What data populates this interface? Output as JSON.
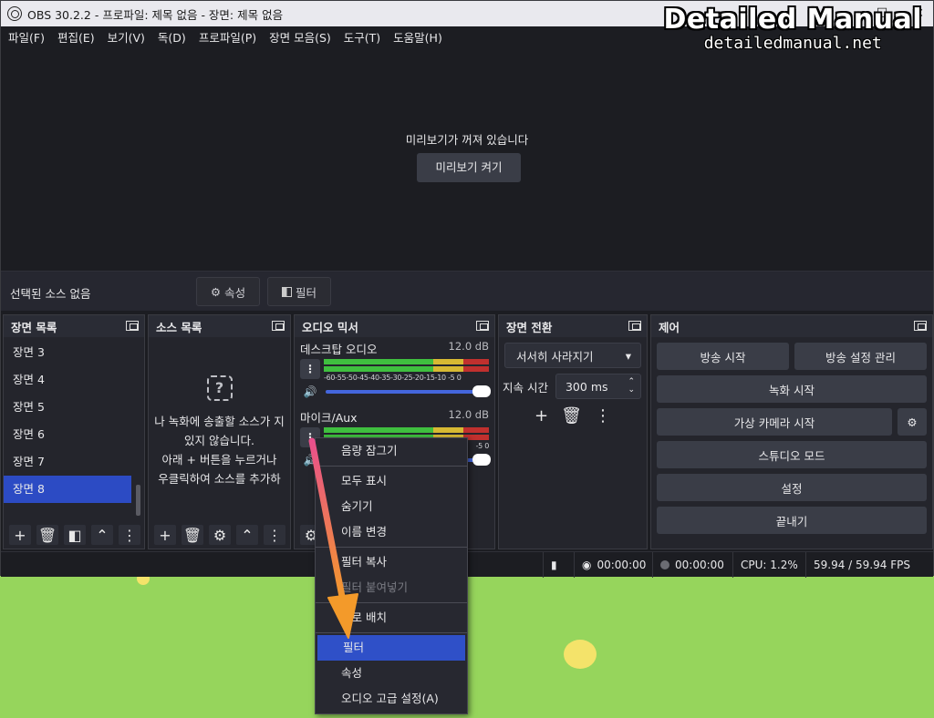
{
  "window": {
    "title": "OBS 30.2.2 - 프로파일: 제목 없음 - 장면: 제목 없음",
    "controls": [
      "–",
      "☐",
      "✕"
    ]
  },
  "watermark": {
    "line1": "Detailed Manual",
    "line2": "detailedmanual.net"
  },
  "menubar": [
    "파일(F)",
    "편집(E)",
    "보기(V)",
    "독(D)",
    "프로파일(P)",
    "장면 모음(S)",
    "도구(T)",
    "도움말(H)"
  ],
  "preview": {
    "message": "미리보기가 꺼져 있습니다",
    "enable_button": "미리보기 켜기"
  },
  "source_bar": {
    "label": "선택된 소스 없음",
    "properties": "속성",
    "filters": "필터"
  },
  "scenes": {
    "title": "장면 목록",
    "items": [
      "장면 3",
      "장면 4",
      "장면 5",
      "장면 6",
      "장면 7",
      "장면 8"
    ],
    "selected": "장면 8"
  },
  "sources": {
    "title": "소스 목록",
    "empty_lines": [
      "나 녹화에 송출할 소스가 지",
      "있지 않습니다.",
      "아래 + 버튼을 누르거나",
      "우클릭하여 소스를 추가하"
    ]
  },
  "mixer": {
    "title": "오디오 믹서",
    "channels": [
      {
        "name": "데스크탑 오디오",
        "db": "12.0 dB",
        "scale": "-60-55-50-45-40-35-30-25-20-15-10 -5  0",
        "volume": 1.0
      },
      {
        "name": "마이크/Aux",
        "db": "12.0 dB",
        "scale": "-5  0",
        "volume": 1.0
      }
    ]
  },
  "transitions": {
    "title": "장면 전환",
    "selected": "서서히 사라지기",
    "duration_label": "지속 시간",
    "duration_value": "300 ms"
  },
  "controls": {
    "title": "제어",
    "start_stream": "방송 시작",
    "stream_settings": "방송 설정 관리",
    "start_record": "녹화 시작",
    "virtual_cam": "가상 카메라 시작",
    "studio_mode": "스튜디오 모드",
    "settings": "설정",
    "exit": "끝내기"
  },
  "status": {
    "stream_time": "00:00:00",
    "record_time": "00:00:00",
    "cpu": "CPU: 1.2%",
    "fps": "59.94 / 59.94 FPS"
  },
  "context_menu": {
    "items": [
      {
        "label": "음량 잠그기",
        "disabled": false
      },
      {
        "sep": true
      },
      {
        "label": "모두 표시",
        "disabled": false
      },
      {
        "label": "숨기기",
        "disabled": false
      },
      {
        "label": "이름 변경",
        "disabled": false
      },
      {
        "sep": true
      },
      {
        "label": "필터 복사",
        "disabled": false
      },
      {
        "label": "필터 붙여넣기",
        "disabled": true
      },
      {
        "sep": true
      },
      {
        "label": "세로 배치",
        "disabled": false
      },
      {
        "sep": true
      },
      {
        "label": "필터",
        "disabled": false,
        "highlighted": true
      },
      {
        "label": "속성",
        "disabled": false
      },
      {
        "label": "오디오 고급 설정(A)",
        "disabled": false
      }
    ]
  },
  "colors": {
    "accent": "#2c4bc4",
    "arrow": "#f08a2a",
    "meter_green": "#3fbf3f",
    "meter_yellow": "#d7b933",
    "meter_red": "#c0302e"
  }
}
